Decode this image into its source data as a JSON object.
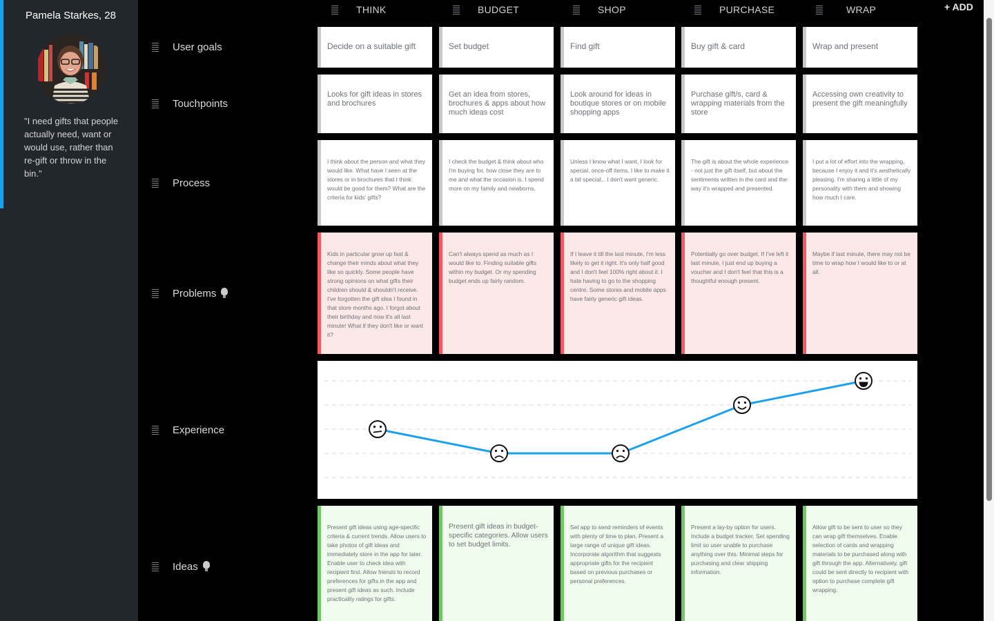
{
  "persona": {
    "name": "Pamela Starkes, 28",
    "quote": "\"I need gifts that people actually need, want or would use, rather than re-gift or throw in the bin.\"",
    "accent_color": "#1aa1ee"
  },
  "stages": [
    "THINK",
    "BUDGET",
    "SHOP",
    "PURCHASE",
    "WRAP"
  ],
  "add_label": "+ ADD",
  "rows": {
    "user_goals": {
      "label": "User goals",
      "cards": [
        "Decide on a suitable gift",
        "Set budget",
        "Find gift",
        "Buy gift & card",
        "Wrap and present"
      ]
    },
    "touchpoints": {
      "label": "Touchpoints",
      "cards": [
        "Looks for gift ideas in stores and brochures",
        "Get an idea from stores, brochures & apps about how much ideas cost",
        "Look around for ideas in boutique stores or on mobile shopping apps",
        "Purchase gift/s, card & wrapping materials from the store",
        "Accessing own creativity to present the gift meaningfully"
      ]
    },
    "process": {
      "label": "Process",
      "cards": [
        "I think about the person and what they would like. What have I seen at the stores or in brochures that I think would be good for them? What are the criteria for kids' gifts?",
        "I check the budget & think about who I'm buying for, how close they are to me and what the occasion is. I spend more on my family and newborns.",
        "Unless I know what I want, I look for special, once-off items. I like to make it a bit special... I don't want generic.",
        "The gift is about the whole experience - not just the gift itself, but about the sentiments written in the card and the way it's wrapped and presented.",
        "I put a lot of effort into the wrapping, because I enjoy it and it's aesthetically pleasing. I'm sharing a little of my personality with them and showing how much I care."
      ]
    },
    "problems": {
      "label": "Problems",
      "icon": "lightbulb-icon",
      "color": "#f25a5f",
      "cards": [
        "Kids in particular grow up fast & change their minds about what they like so quickly. Some people have strong opinions on what gifts their children should & shouldn't receive. I've forgotten the gift idea I found in that store months ago. I forgot about their birthday and now it's all last minute! What if they don't like or want it?",
        "Can't always spend as much as I would like to. Finding suitable gifts within my budget. Or my spending budget ends up fairly random.",
        "If I leave it till the last minute, I'm less likely to get it right. It's only half good and I don't feel 100% right about it. I hate having to go to the shopping centre. Some stores and mobile apps have fairly generic gift ideas.",
        "Potentially go over budget. If I've left it last minute, I just end up buying a voucher and I don't feel that this is a thoughtful enough present.",
        "Maybe if last minute, there may not be time to wrap how I would like to or at all."
      ]
    },
    "experience": {
      "label": "Experience"
    },
    "ideas": {
      "label": "Ideas",
      "icon": "lightbulb-icon",
      "color": "#6fc865",
      "cards": [
        "Present gift ideas using age-specific criteria & current trends. Allow users to take photos of gift ideas and immediately store in the app for later. Enable user to check idea with recipient first. Allow friends to record preferences for gifts in the app and present gift ideas as such. Include practicality ratings for gifts.",
        "Present gift ideas in budget-specific categories. Allow users to set budget limits.",
        "Set app to send reminders of events with plenty of time to plan. Present a large range of unique gift ideas. Incorporate algorithm that suggests appropriate gifts for the recipient based on previous purchases or personal preferences.",
        "Present a lay-by option for users. Include a budget tracker. Set spending limit so user unable to purchase anything over this. Minimal steps for purchasing and clear shipping information.",
        "Allow gift to be sent to user so they can wrap gift themselves. Enable selection of cards and wrapping materials to be purchased along with gift through the app. Alternatively, gift could be sent directly to recipient with option to purchase complete gift wrapping."
      ]
    }
  },
  "chart_data": {
    "type": "line",
    "title": "Experience",
    "categories": [
      "THINK",
      "BUDGET",
      "SHOP",
      "PURCHASE",
      "WRAP"
    ],
    "values": [
      3,
      2,
      2,
      4,
      5
    ],
    "markers": [
      "neutral-face",
      "sad-face",
      "sad-face",
      "smile-face",
      "grin-face"
    ],
    "ylim": [
      1,
      5
    ],
    "grid": true,
    "line_color": "#1aa1ee",
    "xlabel": "",
    "ylabel": ""
  }
}
